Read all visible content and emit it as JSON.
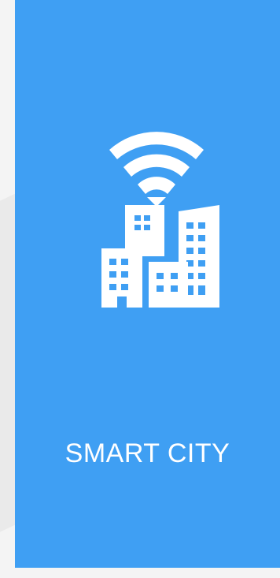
{
  "card": {
    "title": "SMART CITY",
    "background_color": "#3f9ff3",
    "icon": "smart-city-icon"
  },
  "colors": {
    "page_background": "#f4f4f4",
    "icon_fill": "#ffffff"
  }
}
